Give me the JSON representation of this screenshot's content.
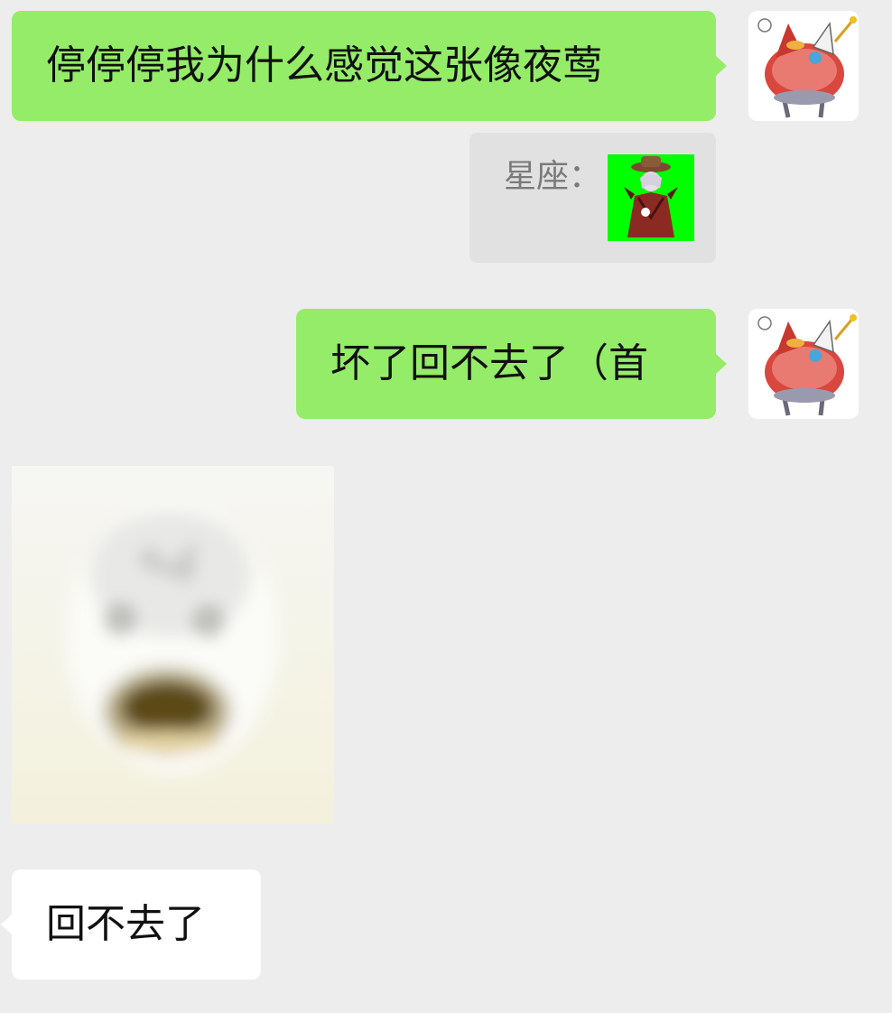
{
  "messages": [
    {
      "side": "right",
      "type": "text",
      "text": "停停停我为什么感觉这张像夜莺"
    },
    {
      "side": "right",
      "type": "quote",
      "sender": "星座："
    },
    {
      "side": "right",
      "type": "text",
      "text": "坏了回不去了（首"
    },
    {
      "side": "left",
      "type": "sticker"
    },
    {
      "side": "left",
      "type": "text",
      "text": "回不去了"
    }
  ],
  "colors": {
    "background": "#ededed",
    "self_bubble": "#95ec69",
    "other_bubble": "#ffffff",
    "quote_bg": "#e1e1e1",
    "quote_text": "#7a7a7a",
    "quote_thumb_bg": "#00ff00"
  }
}
